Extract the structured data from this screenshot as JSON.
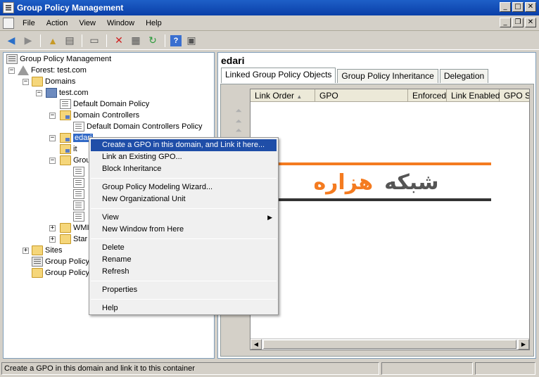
{
  "window": {
    "title": "Group Policy Management"
  },
  "menubar": {
    "items": [
      "File",
      "Action",
      "View",
      "Window",
      "Help"
    ]
  },
  "toolbar": {
    "icons": [
      "back-icon",
      "forward-icon",
      "up-folder-icon",
      "show-hide-tree-icon",
      "properties-icon",
      "delete-icon",
      "export-icon",
      "refresh-icon",
      "help-icon",
      "new-window-icon"
    ]
  },
  "tree": {
    "root": "Group Policy Management",
    "forest": "Forest: test.com",
    "domains": "Domains",
    "domain": "test.com",
    "default_domain_policy": "Default Domain Policy",
    "domain_controllers": "Domain Controllers",
    "default_dc_policy": "Default Domain Controllers Policy",
    "edari": "edari",
    "it": "it",
    "group_objects": "Grou",
    "wmi": "WMI",
    "starter": "Star",
    "sites": "Sites",
    "gp_modeling": "Group Policy",
    "gp_results": "Group Policy"
  },
  "detail": {
    "title": "edari",
    "tabs": [
      "Linked Group Policy Objects",
      "Group Policy Inheritance",
      "Delegation"
    ],
    "columns": [
      "Link Order",
      "GPO",
      "Enforced",
      "Link Enabled",
      "GPO St"
    ]
  },
  "context_menu": {
    "items": [
      "Create a GPO in this domain, and Link it here...",
      "Link an Existing GPO...",
      "Block Inheritance",
      "Group Policy Modeling Wizard...",
      "New Organizational Unit",
      "View",
      "New Window from Here",
      "Delete",
      "Rename",
      "Refresh",
      "Properties",
      "Help"
    ],
    "highlighted_index": 0
  },
  "logo": {
    "word1": "شبکه",
    "word2": "هزاره",
    "accent": "#f47b20"
  },
  "status": {
    "text": "Create a GPO in this domain and link it to this container"
  }
}
